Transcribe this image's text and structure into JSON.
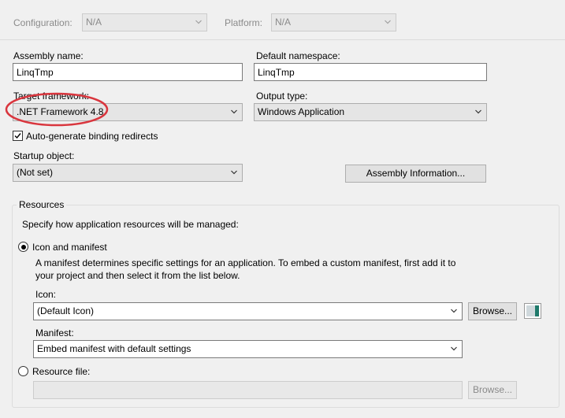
{
  "top_bar": {
    "configuration_label": "Configuration:",
    "configuration_value": "N/A",
    "platform_label": "Platform:",
    "platform_value": "N/A"
  },
  "assembly_name": {
    "label": "Assembly name:",
    "value": "LinqTmp"
  },
  "default_namespace": {
    "label": "Default namespace:",
    "value": "LinqTmp"
  },
  "target_framework": {
    "label": "Target framework:",
    "value": ".NET Framework 4.8"
  },
  "output_type": {
    "label": "Output type:",
    "value": "Windows Application"
  },
  "auto_generate": {
    "label": "Auto-generate binding redirects",
    "checked": true
  },
  "startup_object": {
    "label": "Startup object:",
    "value": "(Not set)"
  },
  "assembly_information_button": "Assembly Information...",
  "resources": {
    "title": "Resources",
    "instructions": "Specify how application resources will be managed:",
    "icon_and_manifest_label": "Icon and manifest",
    "description_line1": "A manifest determines specific settings for an application. To embed a custom manifest, first add it to",
    "description_line2": "your project and then select it from the list below.",
    "icon_label": "Icon:",
    "icon_value": "(Default Icon)",
    "browse_label": "Browse...",
    "manifest_label": "Manifest:",
    "manifest_value": "Embed manifest with default settings",
    "resource_file_label": "Resource file:",
    "resource_file_value": "",
    "resource_browse_label": "Browse..."
  },
  "colors": {
    "highlight_ellipse": "#d9363e",
    "window_bg": "#f0f0f0"
  },
  "icons": [
    "chevron-down-icon",
    "checkmark-icon",
    "icon-preview"
  ]
}
